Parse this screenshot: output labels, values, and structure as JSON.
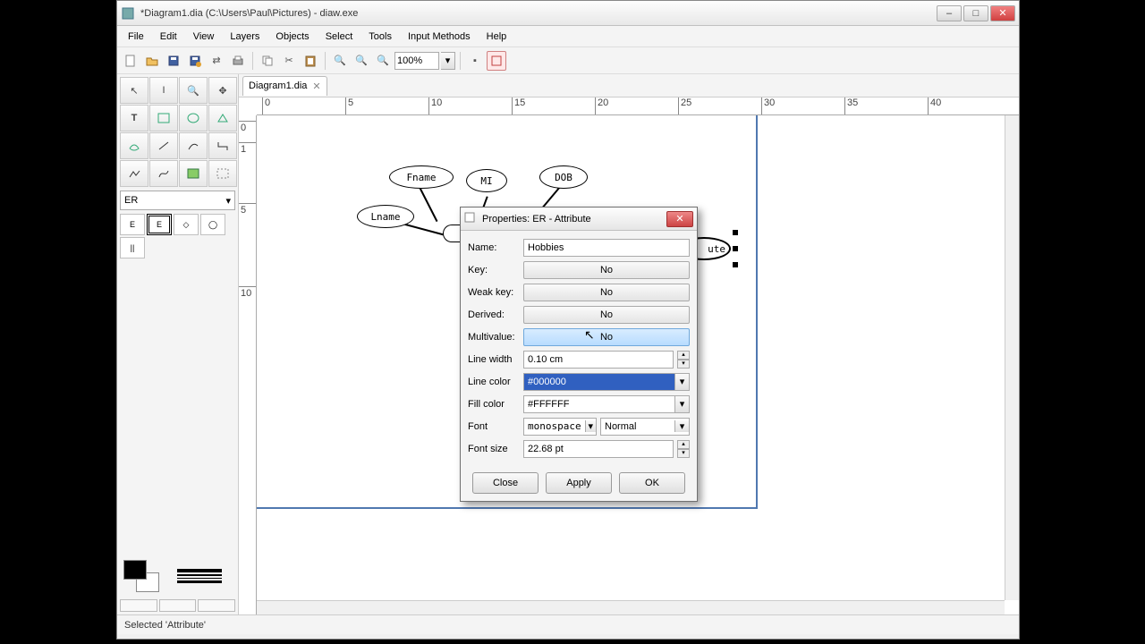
{
  "window": {
    "title": "*Diagram1.dia (C:\\Users\\Paul\\Pictures) - diaw.exe"
  },
  "menu": [
    "File",
    "Edit",
    "View",
    "Layers",
    "Objects",
    "Select",
    "Tools",
    "Input Methods",
    "Help"
  ],
  "zoom": "100%",
  "tab": "Diagram1.dia",
  "sheet": "ER",
  "ruler_h": [
    "0",
    "5",
    "10",
    "15",
    "20",
    "25",
    "30",
    "35",
    "40"
  ],
  "ruler_v": [
    "0",
    "1",
    "5",
    "10"
  ],
  "er_nodes": {
    "fname": "Fname",
    "mi": "MI",
    "dob": "DOB",
    "lname": "Lname",
    "rear_fragment": "ute"
  },
  "dialog": {
    "title": "Properties: ER - Attribute",
    "labels": {
      "name": "Name:",
      "key": "Key:",
      "weakkey": "Weak key:",
      "derived": "Derived:",
      "multivalue": "Multivalue:",
      "linewidth": "Line width",
      "linecolor": "Line color",
      "fillcolor": "Fill color",
      "font": "Font",
      "fontsize": "Font size"
    },
    "values": {
      "name": "Hobbies",
      "key": "No",
      "weakkey": "No",
      "derived": "No",
      "multivalue": "No",
      "linewidth": "0.10 cm",
      "linecolor": "#000000",
      "fillcolor": "#FFFFFF",
      "font": "monospace",
      "fontstyle": "Normal",
      "fontsize": "22.68 pt"
    },
    "buttons": {
      "close": "Close",
      "apply": "Apply",
      "ok": "OK"
    }
  },
  "status": "Selected 'Attribute'"
}
